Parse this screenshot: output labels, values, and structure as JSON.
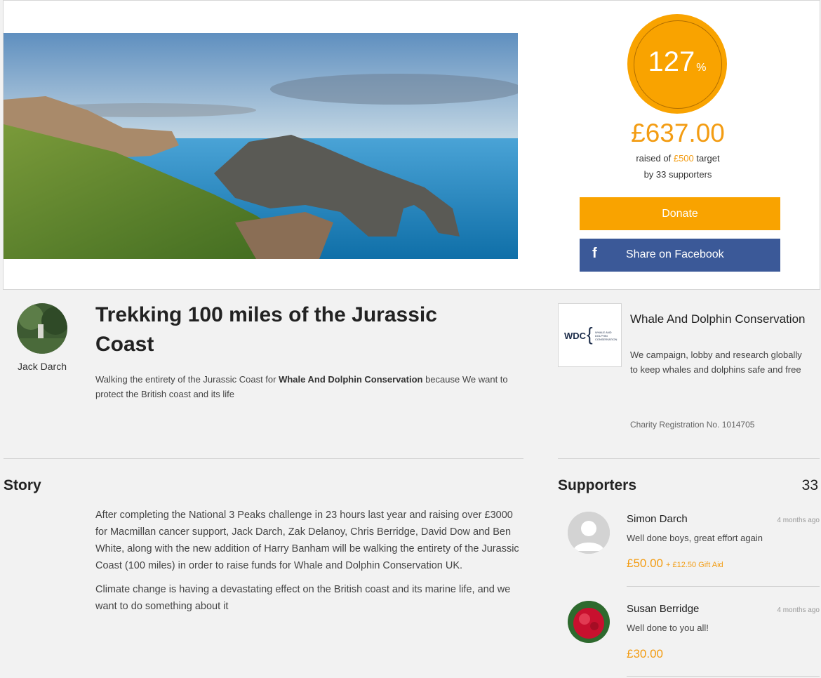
{
  "progress": {
    "percent_value": "127",
    "percent_sign": "%",
    "fraction": 1.27
  },
  "totals": {
    "raised": "£637.00",
    "raised_prefix": "raised of",
    "target": "£500",
    "target_suffix": "target",
    "by_prefix": "by",
    "supporters_count": "33",
    "supporters_suffix": "supporters"
  },
  "buttons": {
    "donate": "Donate",
    "share_facebook": "Share on Facebook",
    "facebook_icon_glyph": "f"
  },
  "page": {
    "owner_name": "Jack Darch",
    "title": "Trekking 100 miles of the Jurassic Coast",
    "desc_prefix": "Walking the entirety of the Jurassic Coast for",
    "desc_charity": "Whale And Dolphin Conservation",
    "desc_suffix": "because We want to protect the British coast and its life"
  },
  "charity": {
    "name": "Whale And Dolphin Conservation",
    "description": "We campaign, lobby and research globally to keep whales and dolphins safe and free",
    "registration": "Charity Registration No. 1014705",
    "logo_text": "WDC",
    "logo_subtext": "WHALE AND DOLPHIN CONSERVATION"
  },
  "story": {
    "heading": "Story",
    "paragraphs": [
      "After completing the National 3 Peaks challenge in 23 hours last year and raising over £3000 for Macmillan cancer support, Jack Darch, Zak Delanoy, Chris Berridge, David Dow and Ben White, along with the new addition of Harry Banham will be walking the entirety of the Jurassic Coast (100 miles) in order to raise funds for Whale and Dolphin Conservation UK.",
      "Climate change is having a devastating effect on the British coast and its marine life, and we want to do something about it"
    ]
  },
  "supporters": {
    "heading": "Supporters",
    "count": "33",
    "items": [
      {
        "name": "Simon Darch",
        "time": "4 months ago",
        "message": "Well done boys, great effort again",
        "amount": "£50.00",
        "gift_aid": "+ £12.50 Gift Aid"
      },
      {
        "name": "Susan Berridge",
        "time": "4 months ago",
        "message": "Well done to you all!",
        "amount": "£30.00",
        "gift_aid": ""
      }
    ]
  },
  "colors": {
    "accent": "#f9a300",
    "accent_text": "#f39c12",
    "facebook": "#3b5998",
    "background": "#f2f2f2"
  }
}
